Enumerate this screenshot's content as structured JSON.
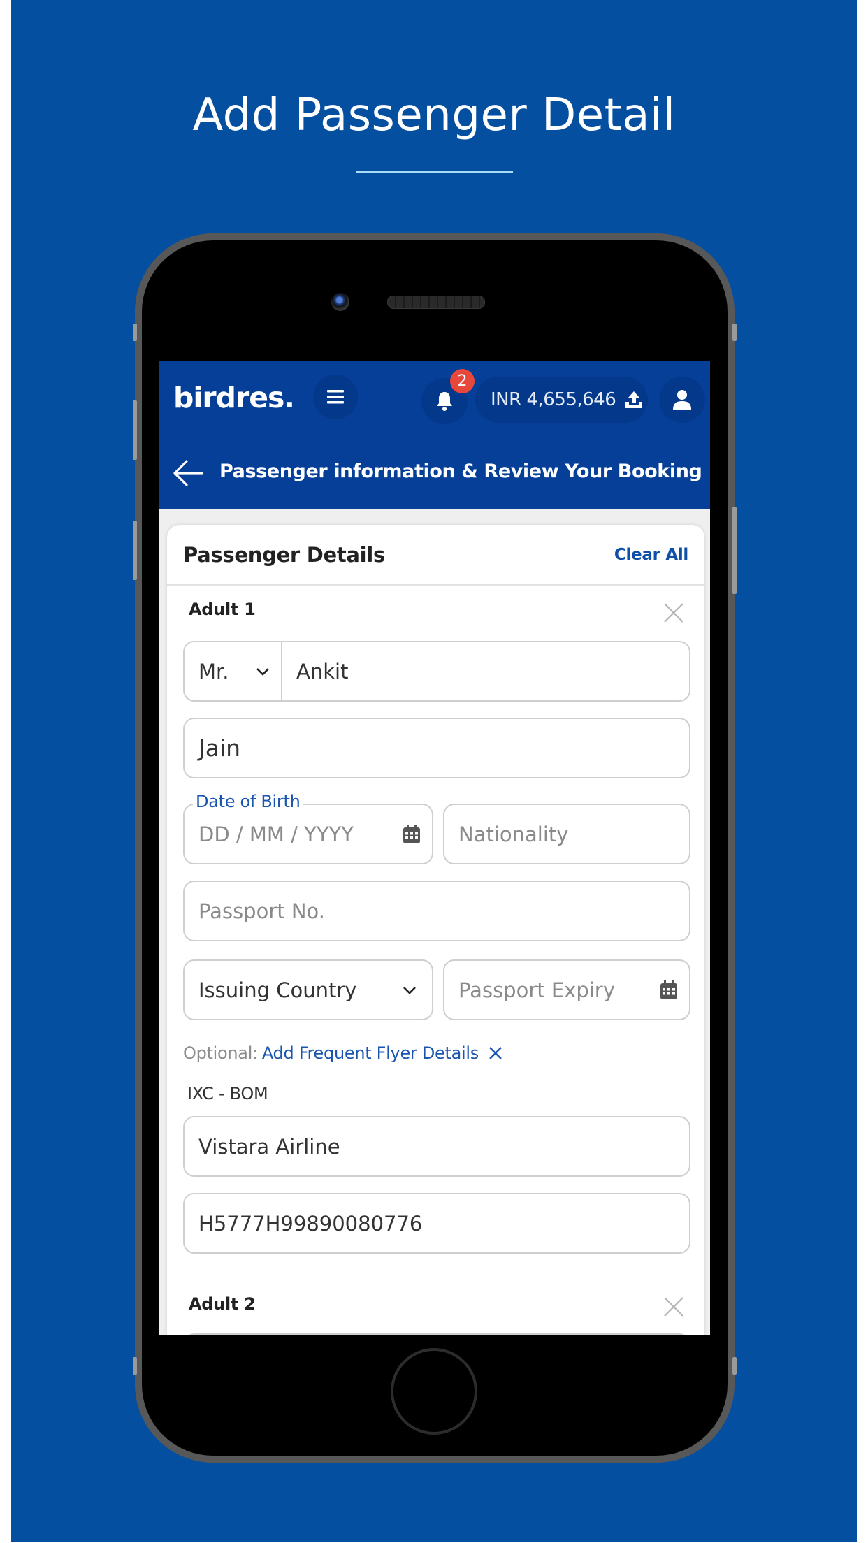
{
  "hero": {
    "title": "Add Passenger Detail"
  },
  "app": {
    "logo": "birdres.",
    "notifications": {
      "count": "2"
    },
    "balance": {
      "label": "INR 4,655,646"
    },
    "page_title": "Passenger information & Review Your Booking"
  },
  "card": {
    "title": "Passenger Details",
    "clear_all": "Clear All",
    "passengers": [
      {
        "label": "Adult 1",
        "title_select": "Mr.",
        "first_name": "Ankit",
        "last_name": "Jain",
        "dob_label": "Date of Birth",
        "dob_placeholder": "DD / MM / YYYY",
        "nationality_placeholder": "Nationality",
        "passport_placeholder": "Passport No.",
        "issuing_country": "Issuing Country",
        "passport_expiry_placeholder": "Passport Expiry",
        "optional_prefix": "Optional:",
        "ff_link": "Add Frequent Flyer Details",
        "route": "IXC - BOM",
        "airline": "Vistara Airline",
        "ff_number": "H5777H99890080776"
      },
      {
        "label": "Adult 2"
      }
    ]
  },
  "colors": {
    "background": "#054fa1",
    "appbar": "#053f97",
    "accent": "#1a56b0",
    "badge": "#e8483b",
    "underline": "#a9dcf5"
  },
  "icons": {
    "menu": "hamburger-icon",
    "notifications": "bell-icon",
    "balance_action": "upload-icon",
    "profile": "user-icon",
    "back": "arrow-left-icon",
    "remove": "close-icon",
    "calendar": "calendar-icon",
    "dropdown": "chevron-down-icon"
  }
}
